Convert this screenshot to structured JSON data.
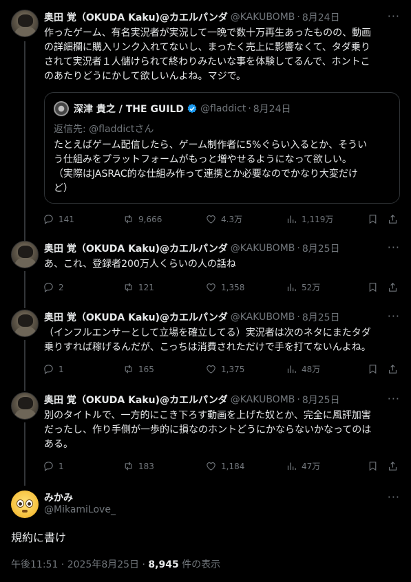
{
  "author_name": "奥田 覚（OKUDA Kaku)@カエルパンダ",
  "author_handle": "@KAKUBOMB",
  "separator": "·",
  "more_label": "···",
  "tweets": [
    {
      "date": "8月24日",
      "lines": [
        "作ったゲーム、有名実況者が実況して一晩で数十万再生あったものの、動画",
        "の詳細欄に購入リンク入れてないし、まったく売上に影響なくて、タダ乗り",
        "されて実況者１人儲けられて終わりみたいな事を体験してるんで、ホントこ",
        "のあたりどうにかして欲しいんよね。マジで。"
      ],
      "replies": "141",
      "retweets": "9,666",
      "likes": "4.3万",
      "views": "1,119万"
    },
    {
      "date": "8月25日",
      "lines": [
        "あ、これ、登録者200万人くらいの人の話ね"
      ],
      "replies": "2",
      "retweets": "121",
      "likes": "1,358",
      "views": "52万"
    },
    {
      "date": "8月25日",
      "lines": [
        "（インフルエンサーとして立場を確立してる）実況者は次のネタにまたタダ",
        "乗りすれば稼げるんだが、こっちは消費されただけで手を打てないんよね。"
      ],
      "replies": "1",
      "retweets": "165",
      "likes": "1,375",
      "views": "48万"
    },
    {
      "date": "8月25日",
      "lines": [
        "別のタイトルで、一方的にこき下ろす動画を上げた奴とか、完全に風評加害",
        "だったし、作り手側が一歩的に損なのホントどうにかならないかなってのは",
        "ある。"
      ],
      "replies": "1",
      "retweets": "183",
      "likes": "1,184",
      "views": "47万"
    }
  ],
  "quote": {
    "name": "深津 貴之 / THE GUILD",
    "handle": "@fladdict",
    "date": "8月24日",
    "reply_to": "返信先: @fladdictさん",
    "lines": [
      "たとえばゲーム配信したら、ゲーム制作者に5%ぐらい入るとか、そうい",
      "う仕組みをプラットフォームがもっと増やせるようになって欲しい。",
      "（実際はJASRAC的な仕組み作って連携とか必要なのでかなり大変だけ",
      "ど）"
    ]
  },
  "main_tweet": {
    "name": "みかみ",
    "handle": "@MikamiLove_",
    "text": "規約に書け",
    "timestamp": "午後11:51 · 2025年8月25日 · ",
    "view_count": "8,945",
    "view_suffix": " 件の表示"
  },
  "colors": {
    "background": "#000000",
    "text": "#e7e9ea",
    "muted": "#71767b",
    "border": "#2f3336",
    "verified": "#1d9bf0"
  }
}
